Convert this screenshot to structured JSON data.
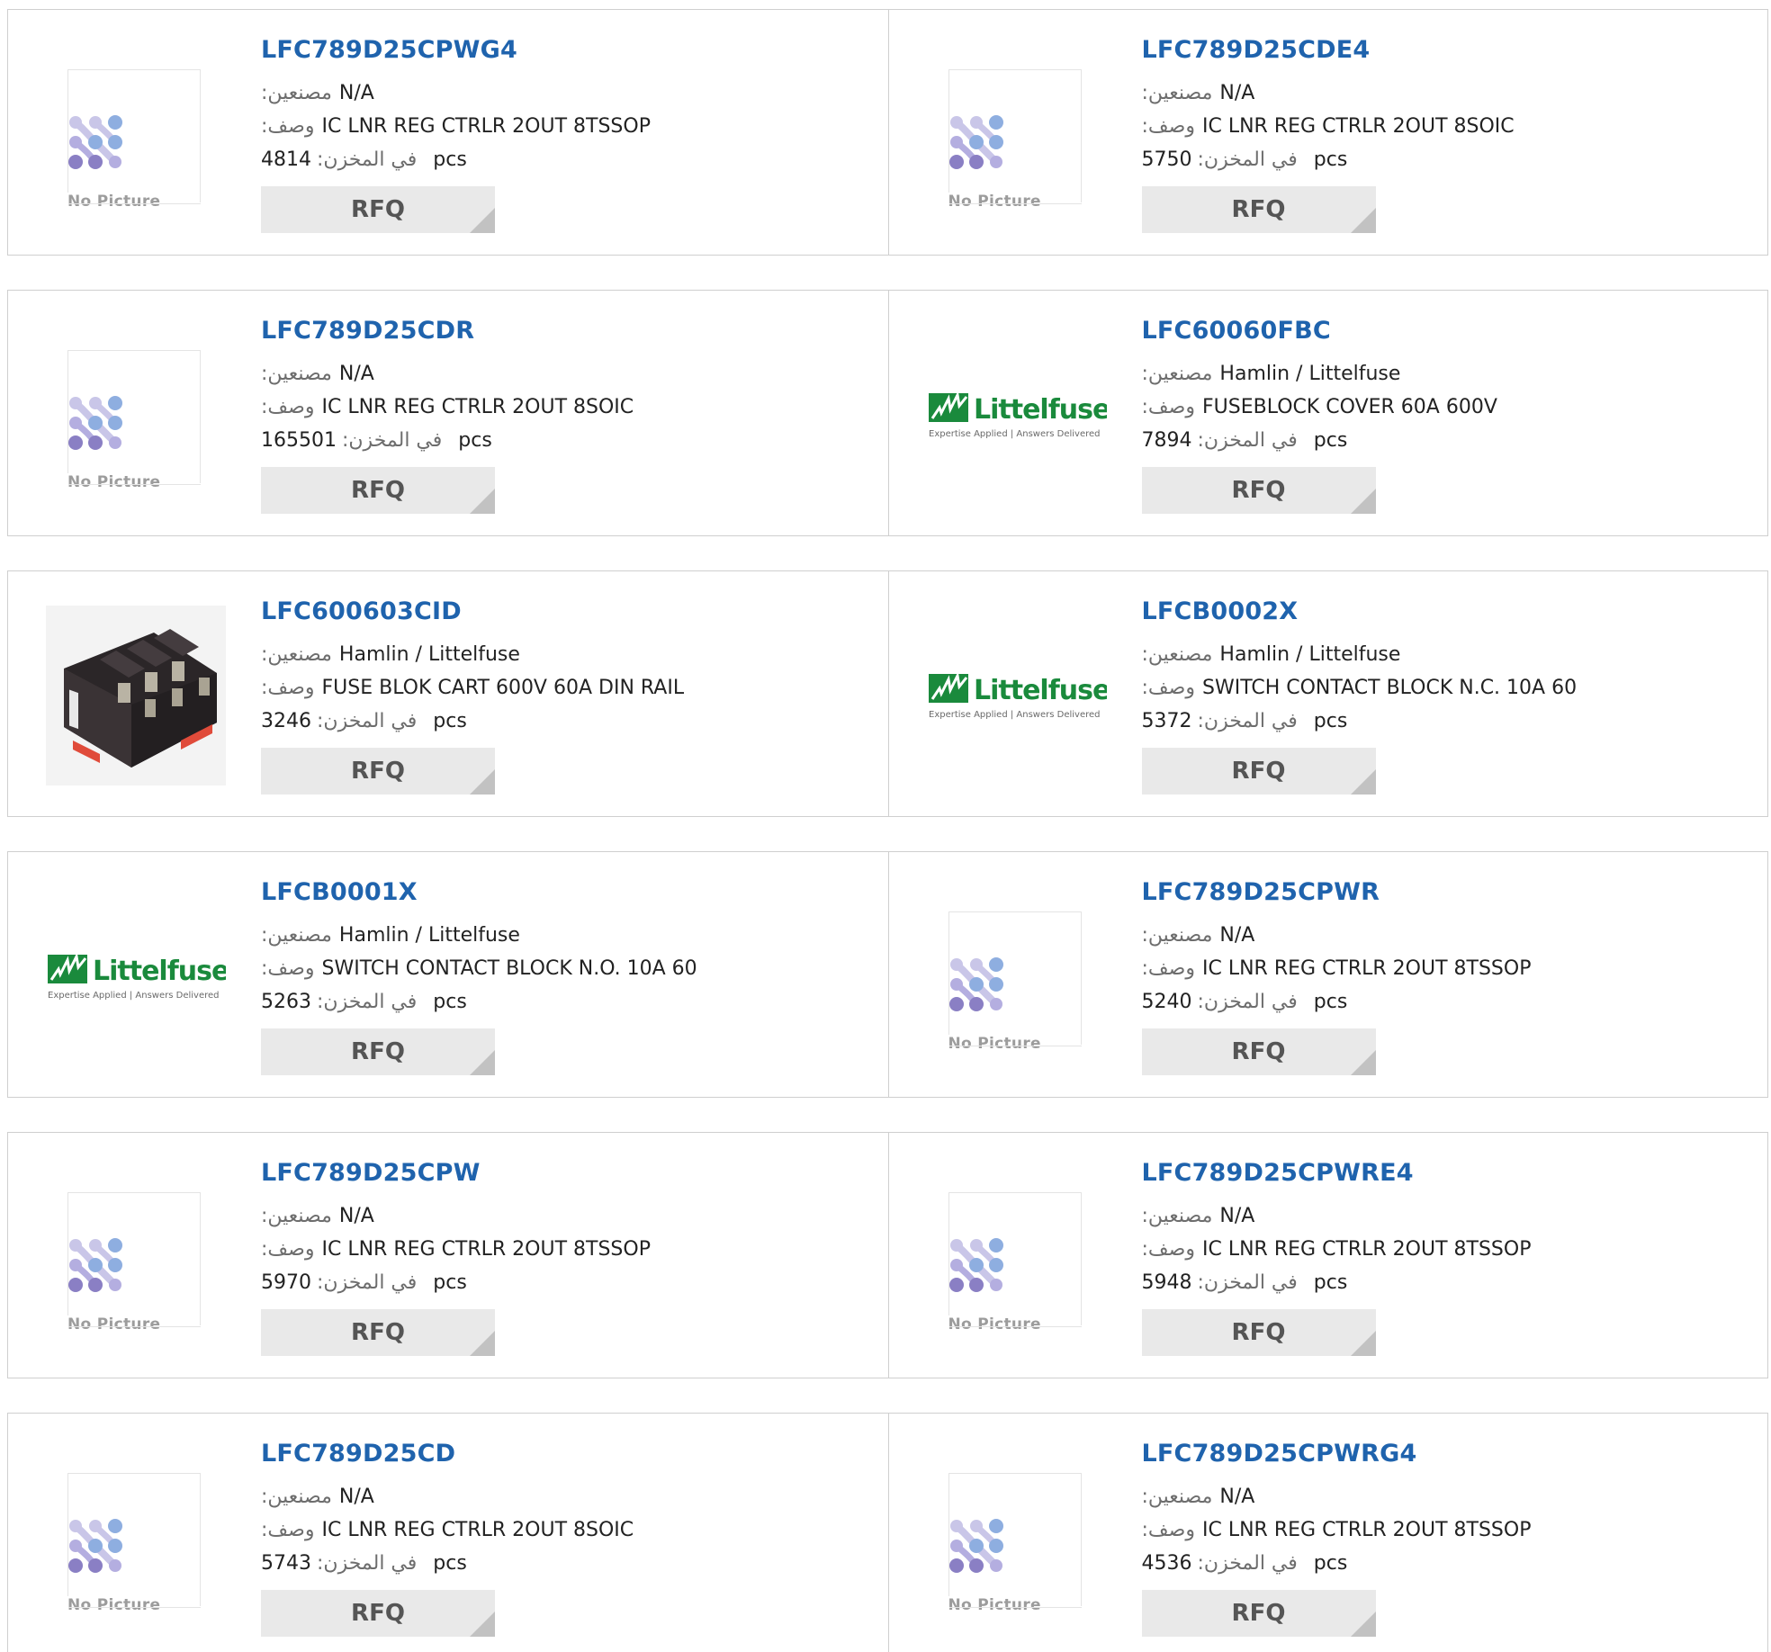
{
  "labels": {
    "manufacturer": "مصنعين:",
    "description": "وصف:",
    "stock": "في المخزن:",
    "unit": "pcs",
    "rfq": "RFQ",
    "no_picture": "No Picture",
    "logo_brand": "Littelfuse",
    "logo_tagline": "Expertise Applied | Answers Delivered"
  },
  "colors": {
    "part_link": "#1f63ad",
    "rfq_bg": "#e9e9e9",
    "logo_green": "#1a8a3c",
    "nopic_blue": "#8eaee0",
    "nopic_purple": "#8a7fc4"
  },
  "products": [
    {
      "part": "LFC789D25CPWG4",
      "manufacturer": "N/A",
      "description": "IC LNR REG CTRLR 2OUT 8TSSOP",
      "stock": "4814",
      "image": "no-picture"
    },
    {
      "part": "LFC789D25CDE4",
      "manufacturer": "N/A",
      "description": "IC LNR REG CTRLR 2OUT 8SOIC",
      "stock": "5750",
      "image": "no-picture"
    },
    {
      "part": "LFC789D25CDR",
      "manufacturer": "N/A",
      "description": "IC LNR REG CTRLR 2OUT 8SOIC",
      "stock": "165501",
      "image": "no-picture"
    },
    {
      "part": "LFC60060FBC",
      "manufacturer": "Hamlin / Littelfuse",
      "description": "FUSEBLOCK COVER 60A 600V",
      "stock": "7894",
      "image": "littelfuse-logo"
    },
    {
      "part": "LFC600603CID",
      "manufacturer": "Hamlin / Littelfuse",
      "description": "FUSE BLOK CART 600V 60A DIN RAIL",
      "stock": "3246",
      "image": "fuse-block-photo"
    },
    {
      "part": "LFCB0002X",
      "manufacturer": "Hamlin / Littelfuse",
      "description": "SWITCH CONTACT BLOCK N.C. 10A 60",
      "stock": "5372",
      "image": "littelfuse-logo"
    },
    {
      "part": "LFCB0001X",
      "manufacturer": "Hamlin / Littelfuse",
      "description": "SWITCH CONTACT BLOCK N.O. 10A 60",
      "stock": "5263",
      "image": "littelfuse-logo"
    },
    {
      "part": "LFC789D25CPWR",
      "manufacturer": "N/A",
      "description": "IC LNR REG CTRLR 2OUT 8TSSOP",
      "stock": "5240",
      "image": "no-picture"
    },
    {
      "part": "LFC789D25CPW",
      "manufacturer": "N/A",
      "description": "IC LNR REG CTRLR 2OUT 8TSSOP",
      "stock": "5970",
      "image": "no-picture"
    },
    {
      "part": "LFC789D25CPWRE4",
      "manufacturer": "N/A",
      "description": "IC LNR REG CTRLR 2OUT 8TSSOP",
      "stock": "5948",
      "image": "no-picture"
    },
    {
      "part": "LFC789D25CD",
      "manufacturer": "N/A",
      "description": "IC LNR REG CTRLR 2OUT 8SOIC",
      "stock": "5743",
      "image": "no-picture"
    },
    {
      "part": "LFC789D25CPWRG4",
      "manufacturer": "N/A",
      "description": "IC LNR REG CTRLR 2OUT 8TSSOP",
      "stock": "4536",
      "image": "no-picture"
    }
  ]
}
